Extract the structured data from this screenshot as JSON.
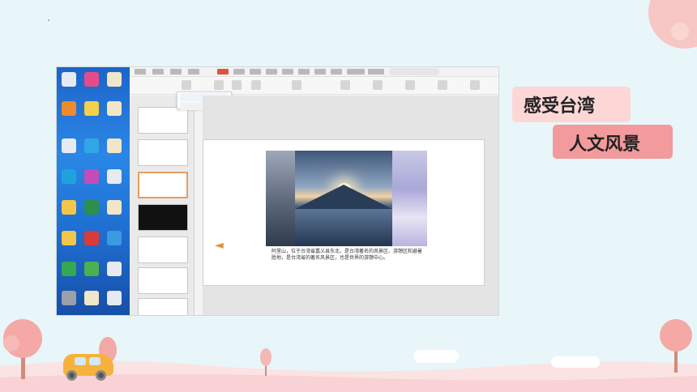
{
  "labels": {
    "line1": "感受台湾",
    "line2": "人文风景"
  },
  "slide": {
    "caption": "阿里山，位于台湾省嘉义县东北，是台湾著名的风景区、游憩区和避暑胜地，是台湾省的著名风景区，也是世界的游憩中心。"
  },
  "colors": {
    "background": "#e8f6f9",
    "label1_bg": "#fdd7d6",
    "label2_bg": "#f29a9c",
    "accent": "#e0533d"
  },
  "icons": {
    "speaker": "speaker-icon"
  }
}
